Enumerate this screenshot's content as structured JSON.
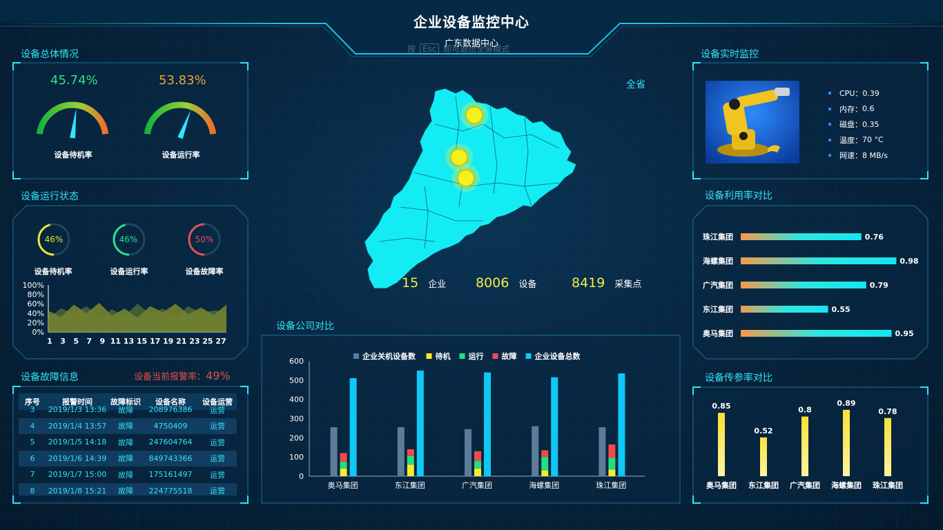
{
  "header": {
    "title": "企业设备监控中心",
    "subtitle": "广东数据中心",
    "esc_hint_prefix": "按",
    "esc_key": "Esc",
    "esc_hint_suffix": "即可退出全屏模式"
  },
  "overview": {
    "title": "设备总体情况",
    "gauges": [
      {
        "value": "45.74%",
        "fraction": 0.4574,
        "label": "设备待机率",
        "color": "#2fe08a"
      },
      {
        "value": "53.83%",
        "fraction": 0.5383,
        "label": "设备运行率",
        "color": "#f0a23a"
      }
    ]
  },
  "run_status": {
    "title": "设备运行状态",
    "rings": [
      {
        "value": "46%",
        "fraction": 0.46,
        "label": "设备待机率",
        "color": "#e6e63a"
      },
      {
        "value": "46%",
        "fraction": 0.46,
        "label": "设备运行率",
        "color": "#2fe08a"
      },
      {
        "value": "50%",
        "fraction": 0.5,
        "label": "设备故障率",
        "color": "#e0505a"
      }
    ],
    "area_chart": {
      "y_ticks": [
        "100%",
        "80%",
        "60%",
        "40%",
        "20%",
        "0%"
      ],
      "x_ticks": [
        "1",
        "3",
        "5",
        "7",
        "9",
        "11",
        "13",
        "15",
        "17",
        "19",
        "21",
        "23",
        "25",
        "27"
      ]
    }
  },
  "faults": {
    "title": "设备故障信息",
    "alarm_label": "设备当前报警率：",
    "alarm_value": "49%",
    "columns": [
      "序号",
      "报警时间",
      "故障标识",
      "设备名称",
      "设备运营"
    ],
    "rows": [
      [
        "3",
        "2019/1/3 13:36",
        "故障",
        "208976386",
        "运营"
      ],
      [
        "4",
        "2019/1/4 13:57",
        "故障",
        "4750409",
        "运营"
      ],
      [
        "5",
        "2019/1/5 14:18",
        "故障",
        "247604764",
        "运营"
      ],
      [
        "6",
        "2019/1/6 14:39",
        "故障",
        "849743366",
        "运营"
      ],
      [
        "7",
        "2019/1/7 15:00",
        "故障",
        "175161497",
        "运营"
      ],
      [
        "8",
        "2019/1/8 15:21",
        "故障",
        "224775518",
        "运营"
      ]
    ]
  },
  "map": {
    "province_button": "全省",
    "stats": [
      {
        "number": "15",
        "label": "企业"
      },
      {
        "number": "8006",
        "label": "设备"
      },
      {
        "number": "8419",
        "label": "采集点"
      }
    ]
  },
  "company_compare": {
    "title": "设备公司对比",
    "colors": {
      "off": "#5b7d99",
      "standby": "#f4ec32",
      "running": "#22e07c",
      "fault": "#ef4b4b",
      "total": "#10c8f5"
    },
    "chart_data": {
      "type": "bar",
      "categories": [
        "奥马集团",
        "东江集团",
        "广汽集团",
        "海螺集团",
        "珠江集团"
      ],
      "series": [
        {
          "name": "企业关机设备数",
          "values": [
            255,
            255,
            245,
            260,
            255
          ]
        },
        {
          "name": "待机",
          "values": [
            40,
            60,
            40,
            30,
            35
          ]
        },
        {
          "name": "运行",
          "values": [
            35,
            45,
            40,
            70,
            60
          ]
        },
        {
          "name": "故障",
          "values": [
            45,
            35,
            50,
            35,
            70
          ]
        },
        {
          "name": "企业设备总数",
          "values": [
            510,
            550,
            540,
            515,
            535
          ]
        }
      ],
      "stacked_series": [
        "待机",
        "运行",
        "故障"
      ],
      "y_ticks": [
        "600",
        "500",
        "400",
        "300",
        "200",
        "100",
        "0"
      ],
      "ylim": [
        0,
        600
      ],
      "legend": "top-center"
    }
  },
  "realtime": {
    "title": "设备实时监控",
    "metrics": [
      {
        "label": "CPU：",
        "value": "0.39"
      },
      {
        "label": "内存：",
        "value": "0.6"
      },
      {
        "label": "磁盘：",
        "value": "0.35"
      },
      {
        "label": "温度：",
        "value": "70 °C"
      },
      {
        "label": "网速：",
        "value": "8 MB/s"
      }
    ]
  },
  "utilization": {
    "title": "设备利用率对比",
    "chart_data": {
      "type": "bar",
      "orientation": "horizontal",
      "categories": [
        "珠江集团",
        "海螺集团",
        "广汽集团",
        "东江集团",
        "奥马集团"
      ],
      "values": [
        0.76,
        0.98,
        0.79,
        0.55,
        0.95
      ],
      "labels": [
        "0.76",
        "0.98",
        "0.79",
        "0.55",
        "0.95"
      ],
      "xlim": [
        0,
        1
      ]
    }
  },
  "transfer": {
    "title": "设备传参率对比",
    "chart_data": {
      "type": "bar",
      "categories": [
        "奥马集团",
        "东江集团",
        "广汽集团",
        "海螺集团",
        "珠江集团"
      ],
      "values": [
        0.85,
        0.52,
        0.8,
        0.89,
        0.78
      ],
      "labels": [
        "0.85",
        "0.52",
        "0.8",
        "0.89",
        "0.78"
      ],
      "ylim": [
        0,
        1
      ]
    }
  }
}
